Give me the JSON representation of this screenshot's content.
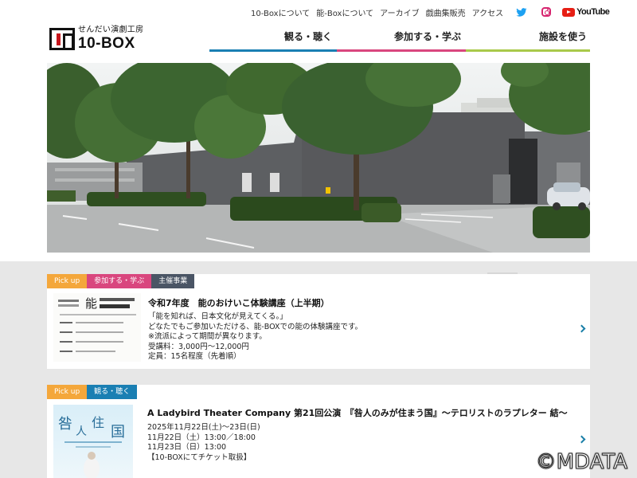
{
  "header": {
    "top_links": [
      "10-Boxについて",
      "能-Boxについて",
      "アーカイブ",
      "戯曲集販売",
      "アクセス"
    ],
    "youtube_label": "YouTube",
    "logo_sub": "せんだい演劇工房",
    "logo_main": "10-BOX"
  },
  "nav": [
    {
      "label": "観る・聴く",
      "color": "#1a7fb3"
    },
    {
      "label": "参加する・学ぶ",
      "color": "#d9467e"
    },
    {
      "label": "施設を使う",
      "color": "#a9c94a"
    }
  ],
  "pickups": [
    {
      "tags": [
        {
          "label": "Pick up",
          "color": "#f4a73b"
        },
        {
          "label": "参加する・学ぶ",
          "color": "#d9467e"
        },
        {
          "label": "主催事業",
          "color": "#4a5565"
        }
      ],
      "title": "令和7年度　能のおけいこ体験講座（上半期）",
      "lines": [
        "「能を知れば、日本文化が見えてくる。」",
        "どなたでもご参加いただける、能-BOXでの能の体験講座です。",
        "※流派によって期間が異なります。",
        "受講料：3,000円～12,000円",
        "定員：15名程度（先着順）"
      ],
      "thumb_text": "能のおけいこ体験講座"
    },
    {
      "tags": [
        {
          "label": "Pick up",
          "color": "#f4a73b"
        },
        {
          "label": "観る・聴く",
          "color": "#1a7fb3"
        }
      ],
      "title": "A Ladybird Theater Company 第21回公演　『咎人のみが住まう国』～テロリストのラプレター 結～",
      "lines": [
        "2025年11月22日(土)～23日(日)",
        "11月22日（土）13:00／18:00",
        "11月23日（日）13:00",
        "【10-BOXにてチケット取扱】"
      ],
      "thumb_text": "咎人のみが住まう国"
    }
  ],
  "copyright": "©MDATA"
}
